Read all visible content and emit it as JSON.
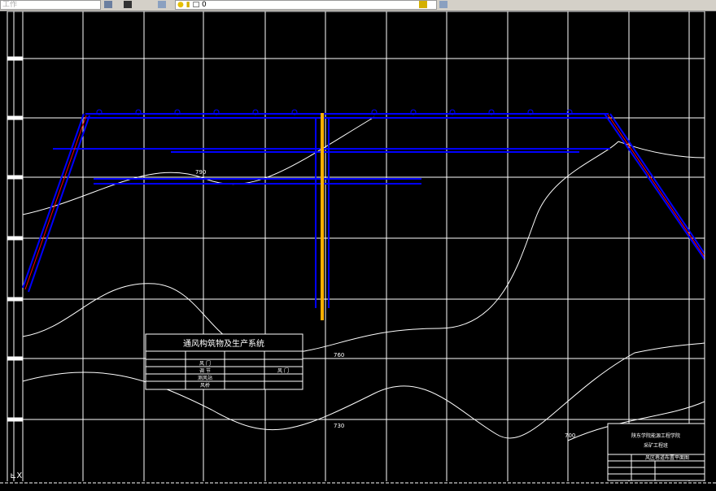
{
  "toolbar": {
    "workspace_combo": "工作",
    "layer_combo": "0",
    "icons": [
      "workspace-settings-icon",
      "layer-properties-icon",
      "light-bulb-icon",
      "sun-icon",
      "lock-icon",
      "color-square-icon",
      "layer-tool-icon",
      "layer-states-icon"
    ]
  },
  "drawing": {
    "legend": {
      "title": "通风构筑物及生产系统",
      "rows": [
        [
          "风 门",
          ""
        ],
        [
          "调 节",
          ""
        ],
        [
          "测风站",
          ""
        ],
        [
          "风桥",
          ""
        ]
      ],
      "extra": [
        "风 门"
      ]
    },
    "contours": [
      "790",
      "760",
      "730",
      "700"
    ],
    "title_block": {
      "school": "陕东学院能源工程学院",
      "class": "采矿工程班",
      "drawing_name": "风区巷道布置平面图"
    }
  },
  "colors": {
    "background": "#000000",
    "grid": "#ffffff",
    "roadway": "#0000ff",
    "shaft": "#ffb000",
    "belt": "#ff0000"
  }
}
